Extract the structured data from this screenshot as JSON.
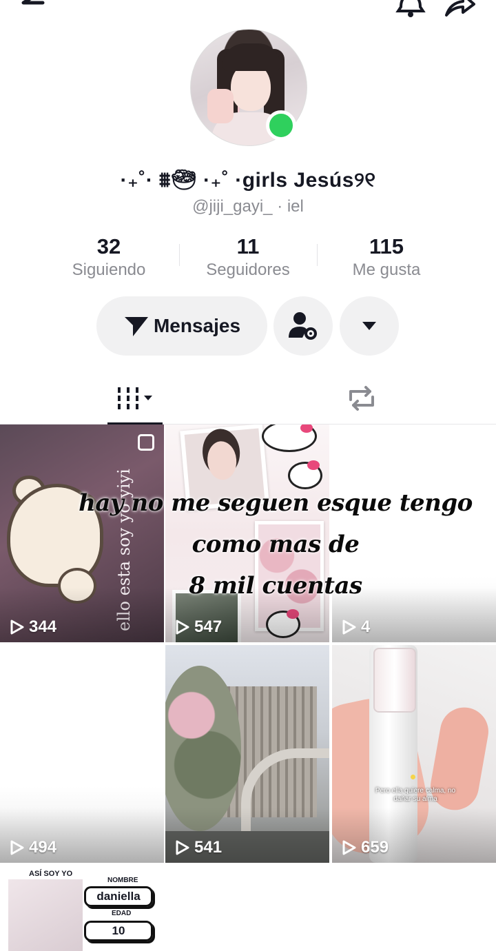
{
  "profile": {
    "display_name": "·₊˚· ⩩︎🥗︎ ·₊˚ ·girls Jesús୨୧",
    "username": "@jiji_gayi_ · iel",
    "online_color": "#2fd05d"
  },
  "stats": [
    {
      "value": "32",
      "label": "Siguiendo"
    },
    {
      "value": "11",
      "label": "Seguidores"
    },
    {
      "value": "115",
      "label": "Me gusta"
    }
  ],
  "actions": {
    "messages_label": "Mensajes"
  },
  "icons": {
    "back": "arrow-left-icon",
    "bell": "bell-icon",
    "share": "share-icon",
    "send": "send-icon",
    "add_friend": "person-settings-icon",
    "dropdown": "caret-down-icon",
    "grid": "grid-icon",
    "repost": "repost-icon",
    "play": "play-icon"
  },
  "videos": [
    {
      "views": "344",
      "text": "ello esta soy yo yiyi"
    },
    {
      "views": "547"
    },
    {
      "views": "4"
    },
    {
      "views": "494"
    },
    {
      "views": "541"
    },
    {
      "views": "659",
      "caption": "Pero ella quiere calma, no dañar su alma"
    }
  ],
  "partial_tile": {
    "heading": "ASÍ SOY YO",
    "name_label": "NOMBRE",
    "name_value": "daniella",
    "age_label": "EDAD",
    "age_value": "10"
  },
  "overlay_text": {
    "line1": "hay no me seguen esque tengo",
    "line2": "como mas de",
    "line3": "8 mil cuentas"
  }
}
